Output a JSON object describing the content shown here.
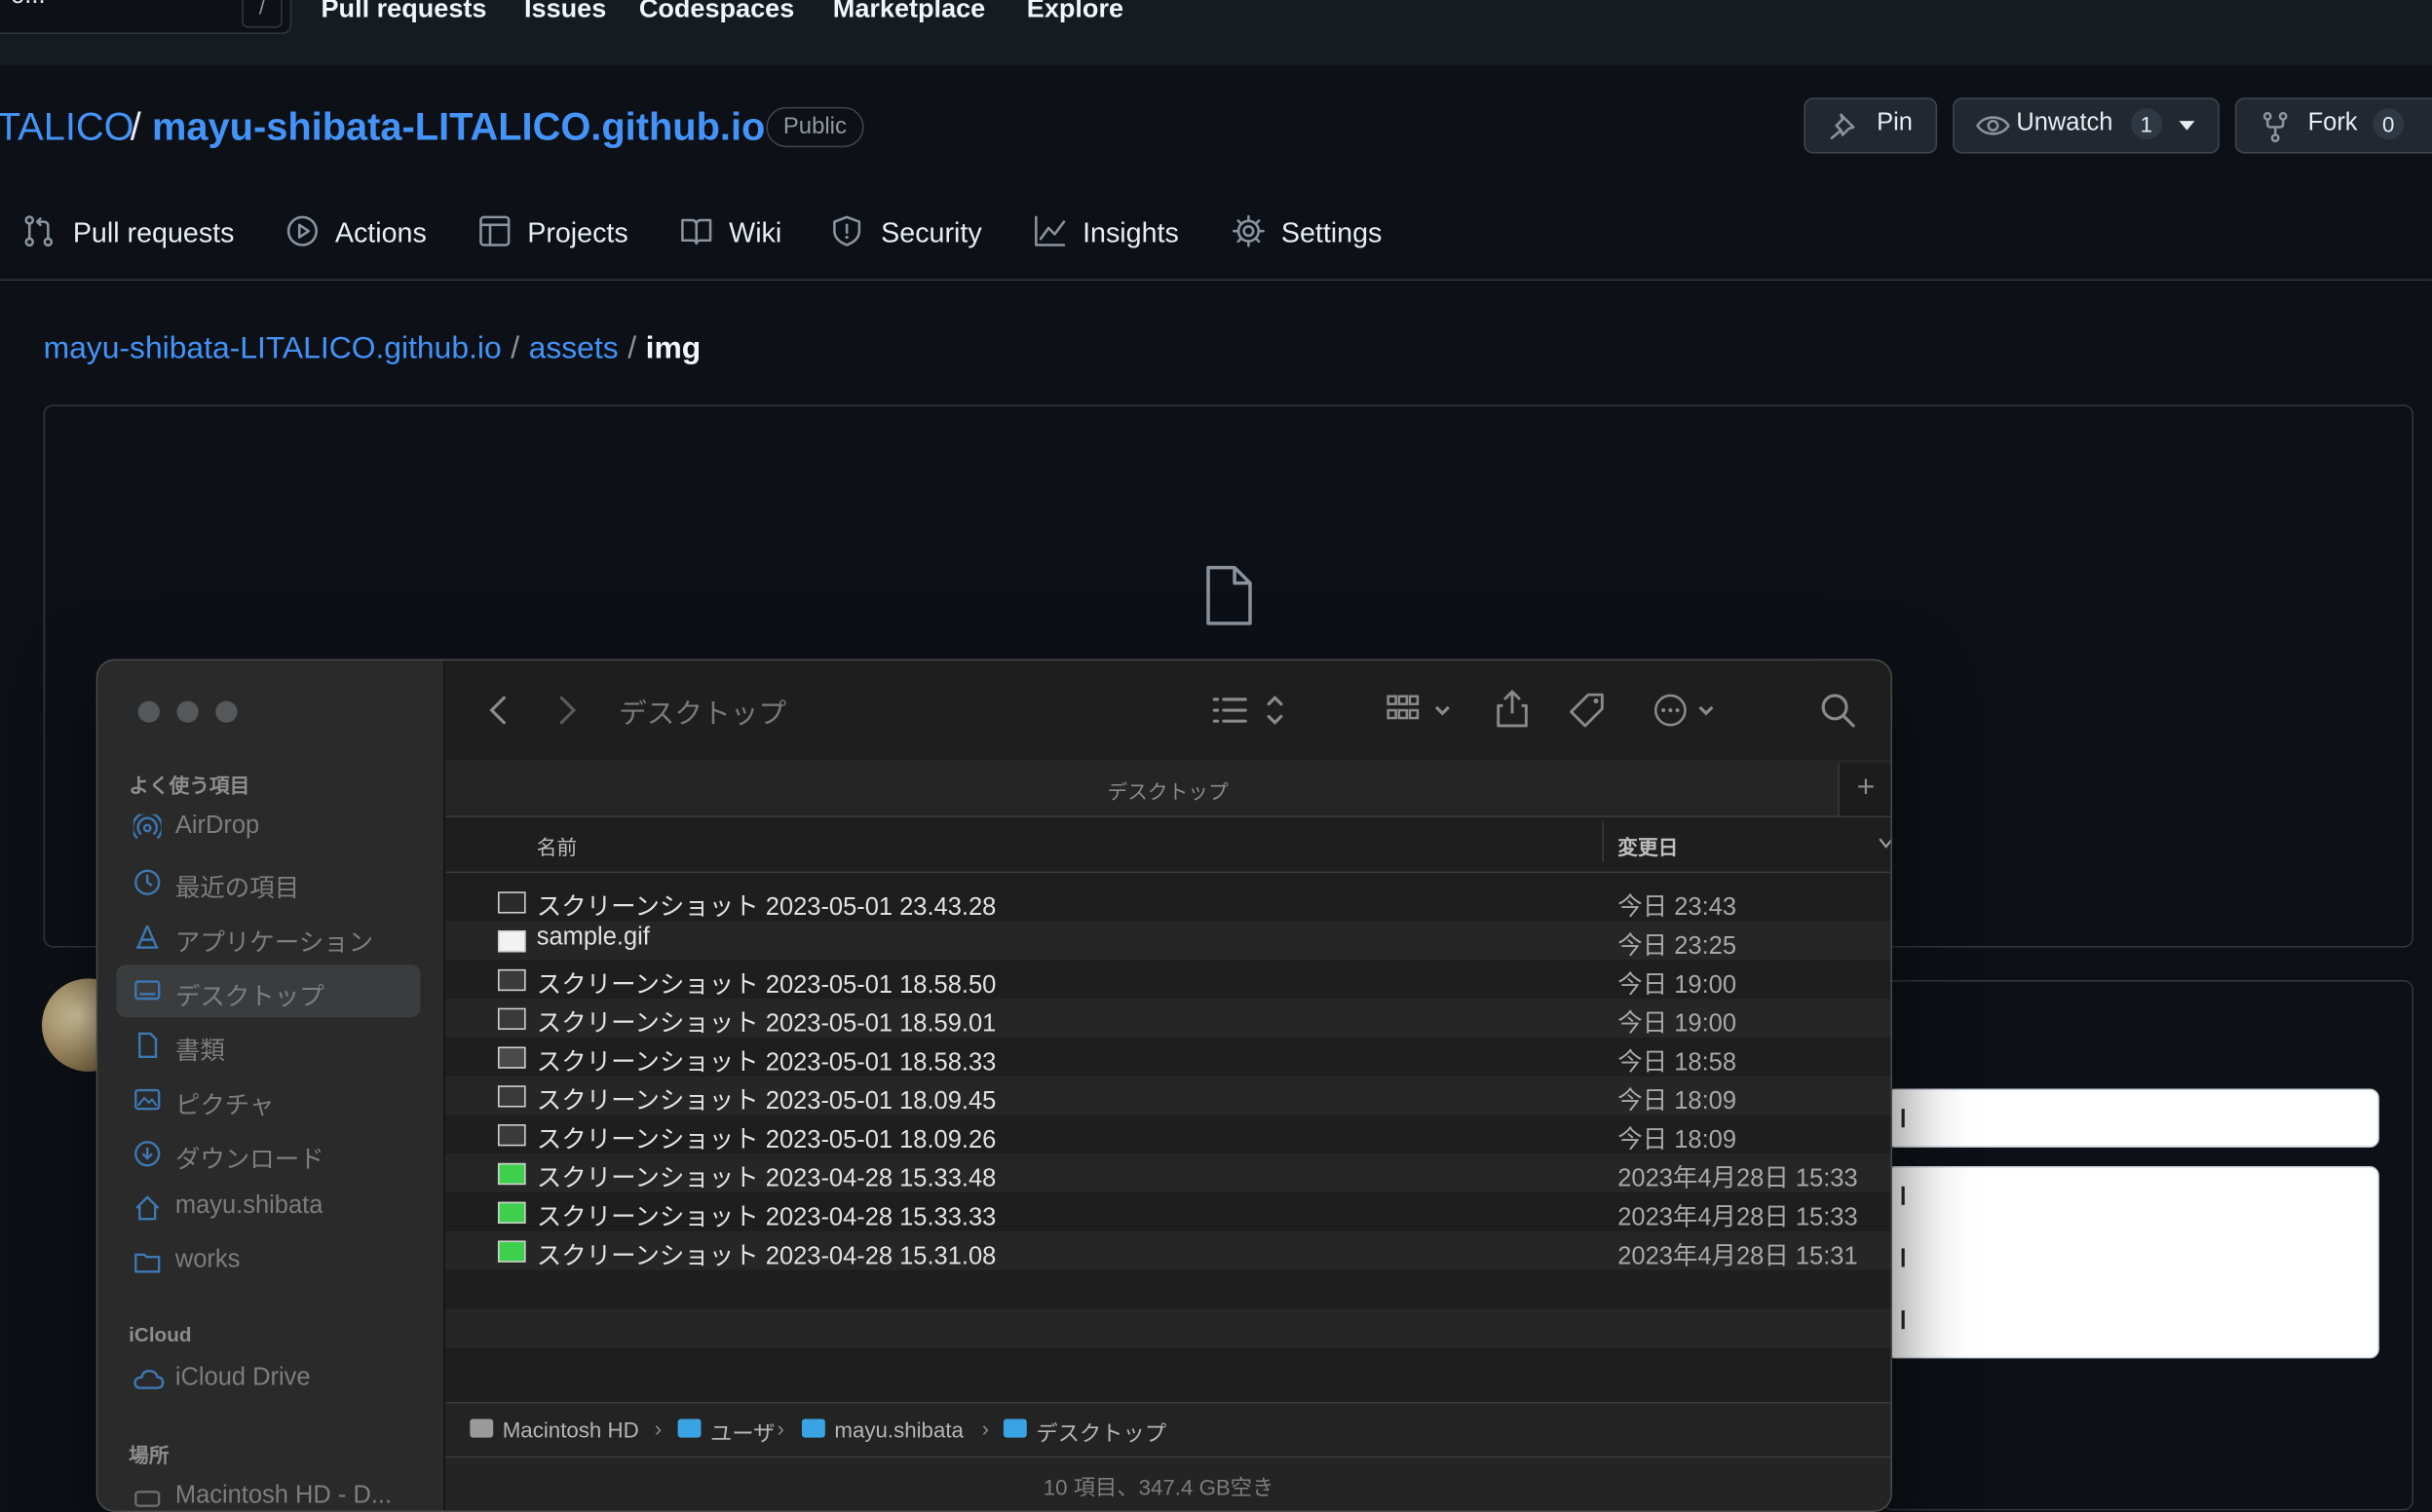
{
  "header": {
    "search_text": "o...",
    "slash_key": "/",
    "nav": [
      "Pull requests",
      "Issues",
      "Codespaces",
      "Marketplace",
      "Explore"
    ]
  },
  "repo": {
    "owner": "TALICO",
    "separator": "/",
    "name": "mayu-shibata-LITALICO.github.io",
    "visibility": "Public",
    "pin_label": "Pin",
    "unwatch_label": "Unwatch",
    "unwatch_count": "1",
    "fork_label": "Fork",
    "fork_count": "0"
  },
  "tabs": [
    "Pull requests",
    "Actions",
    "Projects",
    "Wiki",
    "Security",
    "Insights",
    "Settings"
  ],
  "breadcrumb": {
    "root": "mayu-shibata-LITALICO.github.io",
    "sep": "/",
    "folder": "assets",
    "current": "img"
  },
  "finder": {
    "title": "デスクトップ",
    "tab_title": "デスクトップ",
    "new_tab": "+",
    "sidebar": {
      "favorites_heading": "よく使う項目",
      "favorites": [
        {
          "label": "AirDrop",
          "icon": "airdrop-icon"
        },
        {
          "label": "最近の項目",
          "icon": "clock-icon"
        },
        {
          "label": "アプリケーション",
          "icon": "applications-icon"
        },
        {
          "label": "デスクトップ",
          "icon": "desktop-icon",
          "selected": true
        },
        {
          "label": "書類",
          "icon": "document-icon"
        },
        {
          "label": "ピクチャ",
          "icon": "photo-icon"
        },
        {
          "label": "ダウンロード",
          "icon": "download-icon"
        },
        {
          "label": "mayu.shibata",
          "icon": "home-icon"
        },
        {
          "label": "works",
          "icon": "folder-icon"
        }
      ],
      "icloud_heading": "iCloud",
      "icloud": [
        {
          "label": "iCloud Drive",
          "icon": "cloud-icon"
        }
      ],
      "locations_heading": "場所",
      "locations": [
        {
          "label": "Macintosh HD - D...",
          "icon": "disk-icon"
        }
      ]
    },
    "columns": {
      "name": "名前",
      "modified": "変更日"
    },
    "files": [
      {
        "name": "スクリーンショット 2023-05-01 23.43.28",
        "date": "今日 23:43",
        "thumb": "#2b2b2b"
      },
      {
        "name": "sample.gif",
        "date": "今日 23:25",
        "thumb": "#f2f2f2"
      },
      {
        "name": "スクリーンショット 2023-05-01 18.58.50",
        "date": "今日 19:00",
        "thumb": "#3a3a3a"
      },
      {
        "name": "スクリーンショット 2023-05-01 18.59.01",
        "date": "今日 19:00",
        "thumb": "#3a3a3a"
      },
      {
        "name": "スクリーンショット 2023-05-01 18.58.33",
        "date": "今日 18:58",
        "thumb": "#4a4a4a"
      },
      {
        "name": "スクリーンショット 2023-05-01 18.09.45",
        "date": "今日 18:09",
        "thumb": "#3a3a3a"
      },
      {
        "name": "スクリーンショット 2023-05-01 18.09.26",
        "date": "今日 18:09",
        "thumb": "#3a3a3a"
      },
      {
        "name": "スクリーンショット 2023-04-28 15.33.48",
        "date": "2023年4月28日 15:33",
        "thumb": "#3ecf4c"
      },
      {
        "name": "スクリーンショット 2023-04-28 15.33.33",
        "date": "2023年4月28日 15:33",
        "thumb": "#3ecf4c"
      },
      {
        "name": "スクリーンショット 2023-04-28 15.31.08",
        "date": "2023年4月28日 15:31",
        "thumb": "#3ecf4c"
      }
    ],
    "path": [
      "Macintosh HD",
      "ユーザ",
      "mayu.shibata",
      "デスクトップ"
    ],
    "path_sep": "›",
    "status": "10 項目、347.4 GB空き"
  },
  "colors": {
    "accent_link": "#4493f8",
    "page_bg": "#0d1117",
    "finder_bg": "#1e1e1e",
    "folder_blue": "#3aa3e3"
  }
}
